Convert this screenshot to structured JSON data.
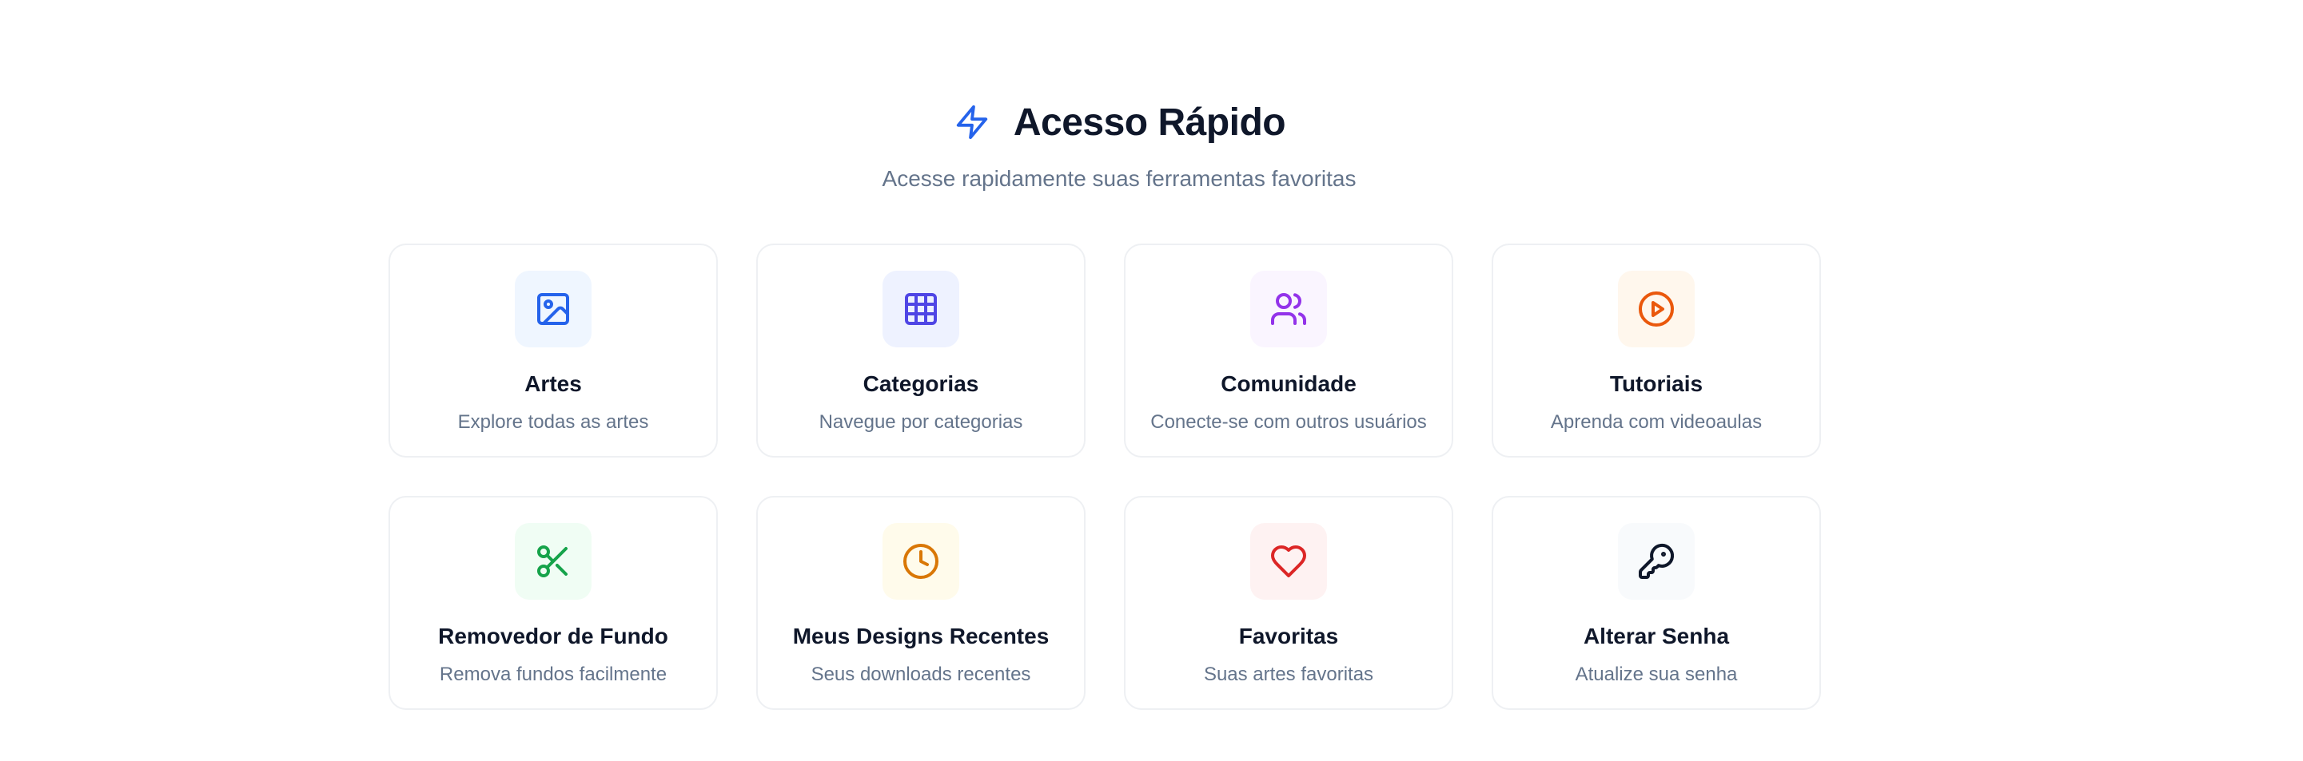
{
  "header": {
    "title": "Acesso Rápido",
    "subtitle": "Acesse rapidamente suas ferramentas favoritas",
    "icon": "lightning-icon",
    "accent_color": "#2563eb"
  },
  "cards": [
    {
      "title": "Artes",
      "description": "Explore todas as artes",
      "icon": "image-icon",
      "color": "#2563eb",
      "bg": "#eff6ff"
    },
    {
      "title": "Categorias",
      "description": "Navegue por categorias",
      "icon": "grid-icon",
      "color": "#4f46e5",
      "bg": "#eef2ff"
    },
    {
      "title": "Comunidade",
      "description": "Conecte-se com outros usuários",
      "icon": "users-icon",
      "color": "#9333ea",
      "bg": "#faf5ff"
    },
    {
      "title": "Tutoriais",
      "description": "Aprenda com videoaulas",
      "icon": "play-circle-icon",
      "color": "#ea580c",
      "bg": "#fff7ed"
    },
    {
      "title": "Removedor de Fundo",
      "description": "Remova fundos facilmente",
      "icon": "scissors-icon",
      "color": "#16a34a",
      "bg": "#f0fdf4"
    },
    {
      "title": "Meus Designs Recentes",
      "description": "Seus downloads recentes",
      "icon": "clock-icon",
      "color": "#d97706",
      "bg": "#fffbeb"
    },
    {
      "title": "Favoritas",
      "description": "Suas artes favoritas",
      "icon": "heart-icon",
      "color": "#dc2626",
      "bg": "#fef2f2"
    },
    {
      "title": "Alterar Senha",
      "description": "Atualize sua senha",
      "icon": "key-icon",
      "color": "#0f172a",
      "bg": "#f8fafc"
    }
  ]
}
